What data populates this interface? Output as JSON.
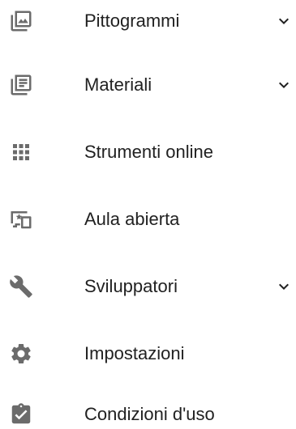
{
  "colors": {
    "icon": "#6b6b6b",
    "text": "#212121",
    "chevron": "#212121"
  },
  "menu": {
    "items": [
      {
        "label": "Pittogrammi",
        "icon": "photo-library-icon",
        "expandable": true
      },
      {
        "label": "Materiali",
        "icon": "library-books-icon",
        "expandable": true
      },
      {
        "label": "Strumenti online",
        "icon": "grid-apps-icon",
        "expandable": false
      },
      {
        "label": "Aula abierta",
        "icon": "devices-star-icon",
        "expandable": false
      },
      {
        "label": "Sviluppatori",
        "icon": "wrench-icon",
        "expandable": true
      },
      {
        "label": "Impostazioni",
        "icon": "gear-icon",
        "expandable": false
      },
      {
        "label": "Condizioni d'uso",
        "icon": "clipboard-check-icon",
        "expandable": false
      }
    ]
  }
}
